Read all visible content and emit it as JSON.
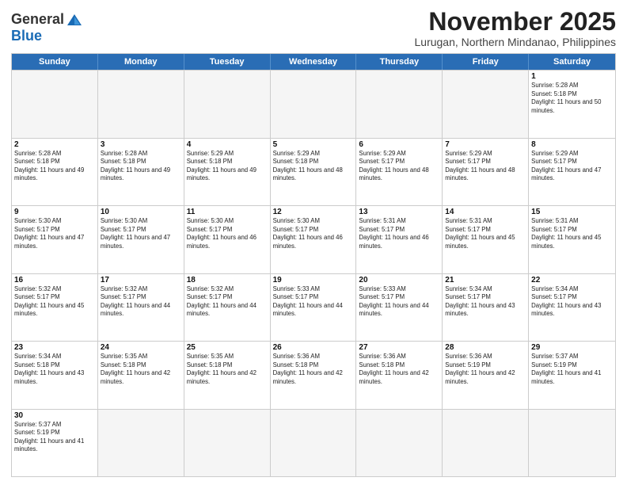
{
  "header": {
    "logo_general": "General",
    "logo_blue": "Blue",
    "month_title": "November 2025",
    "location": "Lurugan, Northern Mindanao, Philippines"
  },
  "days_of_week": [
    "Sunday",
    "Monday",
    "Tuesday",
    "Wednesday",
    "Thursday",
    "Friday",
    "Saturday"
  ],
  "weeks": [
    [
      {
        "day": "",
        "info": ""
      },
      {
        "day": "",
        "info": ""
      },
      {
        "day": "",
        "info": ""
      },
      {
        "day": "",
        "info": ""
      },
      {
        "day": "",
        "info": ""
      },
      {
        "day": "",
        "info": ""
      },
      {
        "day": "1",
        "sunrise": "Sunrise: 5:28 AM",
        "sunset": "Sunset: 5:18 PM",
        "daylight": "Daylight: 11 hours and 50 minutes."
      }
    ],
    [
      {
        "day": "2",
        "sunrise": "Sunrise: 5:28 AM",
        "sunset": "Sunset: 5:18 PM",
        "daylight": "Daylight: 11 hours and 49 minutes."
      },
      {
        "day": "3",
        "sunrise": "Sunrise: 5:28 AM",
        "sunset": "Sunset: 5:18 PM",
        "daylight": "Daylight: 11 hours and 49 minutes."
      },
      {
        "day": "4",
        "sunrise": "Sunrise: 5:29 AM",
        "sunset": "Sunset: 5:18 PM",
        "daylight": "Daylight: 11 hours and 49 minutes."
      },
      {
        "day": "5",
        "sunrise": "Sunrise: 5:29 AM",
        "sunset": "Sunset: 5:18 PM",
        "daylight": "Daylight: 11 hours and 48 minutes."
      },
      {
        "day": "6",
        "sunrise": "Sunrise: 5:29 AM",
        "sunset": "Sunset: 5:17 PM",
        "daylight": "Daylight: 11 hours and 48 minutes."
      },
      {
        "day": "7",
        "sunrise": "Sunrise: 5:29 AM",
        "sunset": "Sunset: 5:17 PM",
        "daylight": "Daylight: 11 hours and 48 minutes."
      },
      {
        "day": "8",
        "sunrise": "Sunrise: 5:29 AM",
        "sunset": "Sunset: 5:17 PM",
        "daylight": "Daylight: 11 hours and 47 minutes."
      }
    ],
    [
      {
        "day": "9",
        "sunrise": "Sunrise: 5:30 AM",
        "sunset": "Sunset: 5:17 PM",
        "daylight": "Daylight: 11 hours and 47 minutes."
      },
      {
        "day": "10",
        "sunrise": "Sunrise: 5:30 AM",
        "sunset": "Sunset: 5:17 PM",
        "daylight": "Daylight: 11 hours and 47 minutes."
      },
      {
        "day": "11",
        "sunrise": "Sunrise: 5:30 AM",
        "sunset": "Sunset: 5:17 PM",
        "daylight": "Daylight: 11 hours and 46 minutes."
      },
      {
        "day": "12",
        "sunrise": "Sunrise: 5:30 AM",
        "sunset": "Sunset: 5:17 PM",
        "daylight": "Daylight: 11 hours and 46 minutes."
      },
      {
        "day": "13",
        "sunrise": "Sunrise: 5:31 AM",
        "sunset": "Sunset: 5:17 PM",
        "daylight": "Daylight: 11 hours and 46 minutes."
      },
      {
        "day": "14",
        "sunrise": "Sunrise: 5:31 AM",
        "sunset": "Sunset: 5:17 PM",
        "daylight": "Daylight: 11 hours and 45 minutes."
      },
      {
        "day": "15",
        "sunrise": "Sunrise: 5:31 AM",
        "sunset": "Sunset: 5:17 PM",
        "daylight": "Daylight: 11 hours and 45 minutes."
      }
    ],
    [
      {
        "day": "16",
        "sunrise": "Sunrise: 5:32 AM",
        "sunset": "Sunset: 5:17 PM",
        "daylight": "Daylight: 11 hours and 45 minutes."
      },
      {
        "day": "17",
        "sunrise": "Sunrise: 5:32 AM",
        "sunset": "Sunset: 5:17 PM",
        "daylight": "Daylight: 11 hours and 44 minutes."
      },
      {
        "day": "18",
        "sunrise": "Sunrise: 5:32 AM",
        "sunset": "Sunset: 5:17 PM",
        "daylight": "Daylight: 11 hours and 44 minutes."
      },
      {
        "day": "19",
        "sunrise": "Sunrise: 5:33 AM",
        "sunset": "Sunset: 5:17 PM",
        "daylight": "Daylight: 11 hours and 44 minutes."
      },
      {
        "day": "20",
        "sunrise": "Sunrise: 5:33 AM",
        "sunset": "Sunset: 5:17 PM",
        "daylight": "Daylight: 11 hours and 44 minutes."
      },
      {
        "day": "21",
        "sunrise": "Sunrise: 5:34 AM",
        "sunset": "Sunset: 5:17 PM",
        "daylight": "Daylight: 11 hours and 43 minutes."
      },
      {
        "day": "22",
        "sunrise": "Sunrise: 5:34 AM",
        "sunset": "Sunset: 5:17 PM",
        "daylight": "Daylight: 11 hours and 43 minutes."
      }
    ],
    [
      {
        "day": "23",
        "sunrise": "Sunrise: 5:34 AM",
        "sunset": "Sunset: 5:18 PM",
        "daylight": "Daylight: 11 hours and 43 minutes."
      },
      {
        "day": "24",
        "sunrise": "Sunrise: 5:35 AM",
        "sunset": "Sunset: 5:18 PM",
        "daylight": "Daylight: 11 hours and 42 minutes."
      },
      {
        "day": "25",
        "sunrise": "Sunrise: 5:35 AM",
        "sunset": "Sunset: 5:18 PM",
        "daylight": "Daylight: 11 hours and 42 minutes."
      },
      {
        "day": "26",
        "sunrise": "Sunrise: 5:36 AM",
        "sunset": "Sunset: 5:18 PM",
        "daylight": "Daylight: 11 hours and 42 minutes."
      },
      {
        "day": "27",
        "sunrise": "Sunrise: 5:36 AM",
        "sunset": "Sunset: 5:18 PM",
        "daylight": "Daylight: 11 hours and 42 minutes."
      },
      {
        "day": "28",
        "sunrise": "Sunrise: 5:36 AM",
        "sunset": "Sunset: 5:19 PM",
        "daylight": "Daylight: 11 hours and 42 minutes."
      },
      {
        "day": "29",
        "sunrise": "Sunrise: 5:37 AM",
        "sunset": "Sunset: 5:19 PM",
        "daylight": "Daylight: 11 hours and 41 minutes."
      }
    ],
    [
      {
        "day": "30",
        "sunrise": "Sunrise: 5:37 AM",
        "sunset": "Sunset: 5:19 PM",
        "daylight": "Daylight: 11 hours and 41 minutes."
      },
      {
        "day": "",
        "info": ""
      },
      {
        "day": "",
        "info": ""
      },
      {
        "day": "",
        "info": ""
      },
      {
        "day": "",
        "info": ""
      },
      {
        "day": "",
        "info": ""
      },
      {
        "day": "",
        "info": ""
      }
    ]
  ]
}
